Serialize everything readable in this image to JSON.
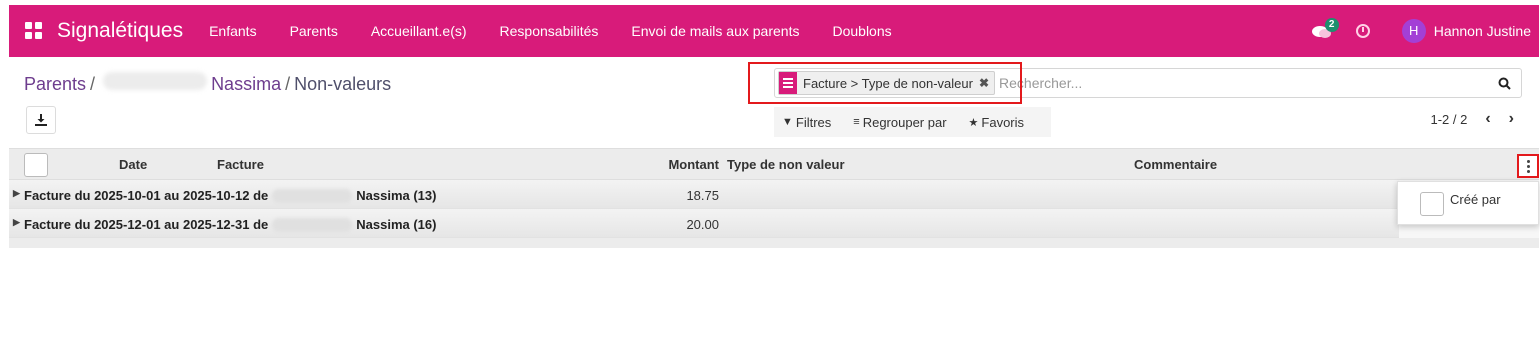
{
  "navbar": {
    "app_title": "Signalétiques",
    "menu": [
      "Enfants",
      "Parents",
      "Accueillant.e(s)",
      "Responsabilités",
      "Envoi de mails aux parents",
      "Doublons"
    ],
    "messages_count": "2",
    "user_initial": "H",
    "user_name": "Hannon Justine",
    "accent_color": "#d81b7a"
  },
  "breadcrumb": {
    "parent": "Parents",
    "separator": "/",
    "record_name": "Nassima",
    "current": "Non-valeurs"
  },
  "search": {
    "facet_label": "Facture > Type de non-valeur",
    "facet_remove": "✖",
    "placeholder": "Rechercher..."
  },
  "filters": {
    "filter_label": "Filtres",
    "group_label": "Regrouper par",
    "favorites_label": "Favoris"
  },
  "pager": {
    "value": "1-2 / 2",
    "prev": "‹",
    "next": "›"
  },
  "table": {
    "columns": {
      "date": "Date",
      "facture": "Facture",
      "montant": "Montant",
      "type": "Type de non valeur",
      "commentaire": "Commentaire"
    },
    "groups": [
      {
        "prefix": "Facture du 2025-10-01 au 2025-10-12 de",
        "suffix": "Nassima (13)",
        "amount": "18.75"
      },
      {
        "prefix": "Facture du 2025-12-01 au 2025-12-31 de",
        "suffix": "Nassima (16)",
        "amount": "20.00"
      }
    ]
  },
  "optional_columns": {
    "items": [
      {
        "label": "Créé par",
        "checked": false
      }
    ]
  }
}
